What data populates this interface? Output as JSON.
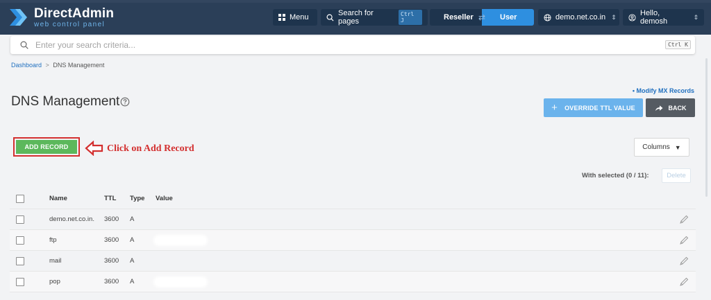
{
  "header": {
    "logo_title": "DirectAdmin",
    "logo_subtitle": "web control panel",
    "menu_label": "Menu",
    "search_pages_label": "Search for pages",
    "search_pages_kbd": "Ctrl J",
    "reseller_label": "Reseller",
    "user_label": "User",
    "domain_label": "demo.net.co.in",
    "hello_label": "Hello, demosh"
  },
  "search": {
    "placeholder": "Enter your search criteria...",
    "kbd": "Ctrl K"
  },
  "breadcrumb": {
    "home": "Dashboard",
    "separator": ">",
    "current": "DNS Management"
  },
  "page": {
    "title": "DNS Management",
    "modify_mx_link": "• Modify MX Records",
    "override_ttl_button": "OVERRIDE TTL VALUE",
    "back_button": "BACK",
    "add_record_button": "ADD RECORD",
    "annotation": "Click on Add Record",
    "columns_button": "Columns",
    "with_selected": "With selected (0 / 11):",
    "delete_button": "Delete"
  },
  "table": {
    "headers": {
      "name": "Name",
      "ttl": "TTL",
      "type": "Type",
      "value": "Value"
    },
    "rows": [
      {
        "name": "demo.net.co.in.",
        "ttl": "3600",
        "type": "A",
        "value": ""
      },
      {
        "name": "ftp",
        "ttl": "3600",
        "type": "A",
        "value": ""
      },
      {
        "name": "mail",
        "ttl": "3600",
        "type": "A",
        "value": ""
      },
      {
        "name": "pop",
        "ttl": "3600",
        "type": "A",
        "value": ""
      }
    ]
  },
  "colors": {
    "header_bg": "#2b3f58",
    "accent_blue": "#2e8fe0",
    "add_record_green": "#5cb85c",
    "annotation_red": "#d32f2f",
    "back_button_gray": "#555b62"
  },
  "icons": {
    "logo": "chevron-logo-icon",
    "menu": "grid-icon",
    "search": "search-icon",
    "swap": "swap-arrows-icon",
    "globe": "globe-icon",
    "user": "user-circle-icon",
    "help": "question-circle-icon",
    "back": "share-arrow-icon",
    "annotation_arrow": "left-arrow-icon",
    "edit": "pencil-icon"
  }
}
